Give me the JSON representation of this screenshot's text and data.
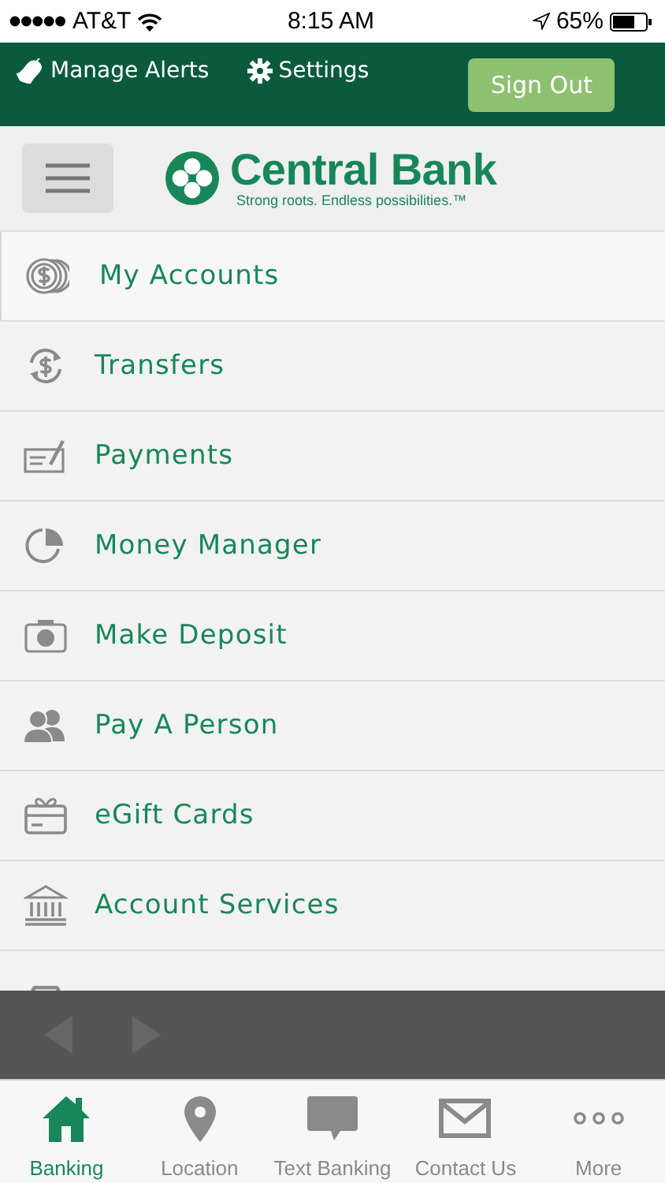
{
  "status_bar": {
    "carrier": "AT&T",
    "time": "8:15 AM",
    "battery": "65%"
  },
  "header": {
    "links": [
      "Manage Alerts",
      "Settings"
    ],
    "sign_out": "Sign Out"
  },
  "brand": {
    "name": "Central Bank",
    "tagline": "Strong roots. Endless possibilities.™"
  },
  "menu": [
    {
      "label": "My Accounts",
      "selected": true
    },
    {
      "label": "Transfers",
      "selected": false
    },
    {
      "label": "Payments",
      "selected": false
    },
    {
      "label": "Money Manager",
      "selected": false
    },
    {
      "label": "Make Deposit",
      "selected": false
    },
    {
      "label": "Pay A Person",
      "selected": false
    },
    {
      "label": "eGift Cards",
      "selected": false
    },
    {
      "label": "Account Services",
      "selected": false
    }
  ],
  "browser_bar": {
    "back_disabled": true,
    "forward_disabled": true
  },
  "tabs": [
    {
      "label": "Banking",
      "selected": true
    },
    {
      "label": "Location",
      "selected": false
    },
    {
      "label": "Text Banking",
      "selected": false
    },
    {
      "label": "Contact Us",
      "selected": false
    },
    {
      "label": "More",
      "selected": false
    }
  ]
}
